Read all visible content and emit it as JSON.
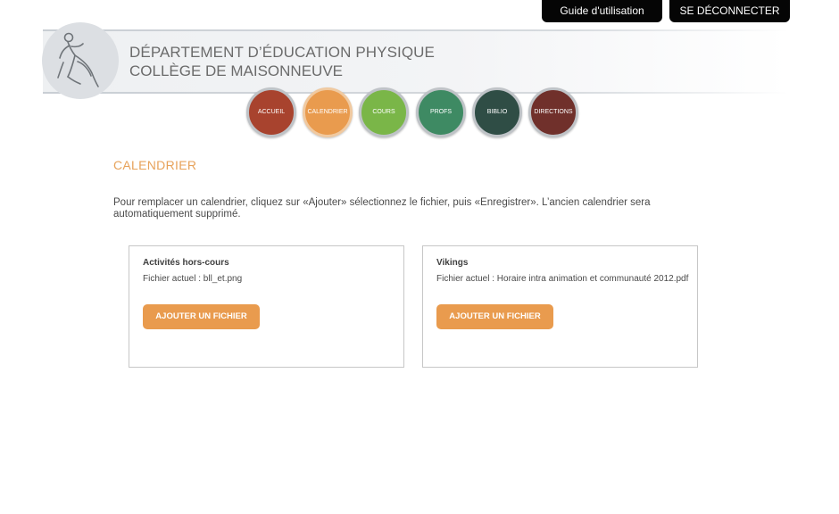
{
  "top_links": {
    "guide_label": "Guide d'utilisation",
    "logout_label": "SE DÉCONNECTER"
  },
  "header": {
    "title": "DÉPARTEMENT D’ÉDUCATION PHYSIQUE",
    "subtitle": "COLLÈGE DE MAISONNEUVE",
    "logo_icon": "runner-logo-icon"
  },
  "nav": {
    "items": [
      {
        "label": "ACCUEIL",
        "color": "#a8432e"
      },
      {
        "label": "CALENDRIER",
        "color": "#e99b4e",
        "active": true
      },
      {
        "label": "COURS",
        "color": "#7ab648"
      },
      {
        "label": "PROFS",
        "color": "#3e8a63"
      },
      {
        "label": "BIBLIO",
        "color": "#2f4d45"
      },
      {
        "label": "DIRECTIONS",
        "color": "#70302b"
      }
    ]
  },
  "main": {
    "heading": "CALENDRIER",
    "heading_color": "#e7a25a",
    "instructions": "Pour remplacer un calendrier, cliquez sur «Ajouter» sélectionnez le fichier, puis «Enregistrer». L’ancien calendrier sera automatiquement supprimé.",
    "cards": [
      {
        "title": "Activités hors-cours",
        "file_text": "Fichier actuel : bll_et.png",
        "button_label": "AJOUTER UN FICHIER"
      },
      {
        "title": "Vikings",
        "file_text": "Fichier actuel : Horaire intra animation et communauté 2012.pdf",
        "button_label": "AJOUTER UN FICHIER"
      }
    ],
    "button_color": "#e99b4e"
  }
}
